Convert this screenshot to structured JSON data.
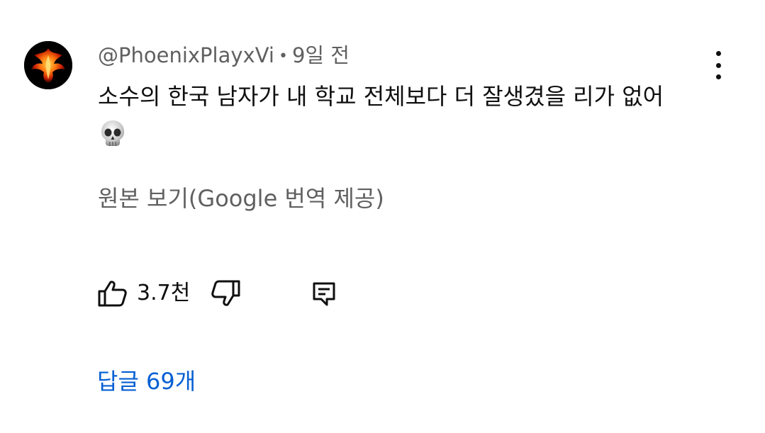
{
  "comment": {
    "author": "@PhoenixPlayxVi",
    "separator": "•",
    "time": "9일 전",
    "text": "소수의 한국 남자가 내 학교 전체보다 더 잘생겼을 리가 없어",
    "emoji": "💀",
    "translation_link": "원본 보기(Google 번역 제공)",
    "likes": "3.7천",
    "replies_label": "답글 69개"
  },
  "icons": {
    "avatar": "phoenix-logo",
    "more": "vertical-ellipsis-icon",
    "like": "thumbs-up-icon",
    "dislike": "thumbs-down-icon",
    "reply": "comment-icon"
  },
  "colors": {
    "meta_text": "#606060",
    "body_text": "#0f0f0f",
    "link_blue": "#065fd4"
  }
}
